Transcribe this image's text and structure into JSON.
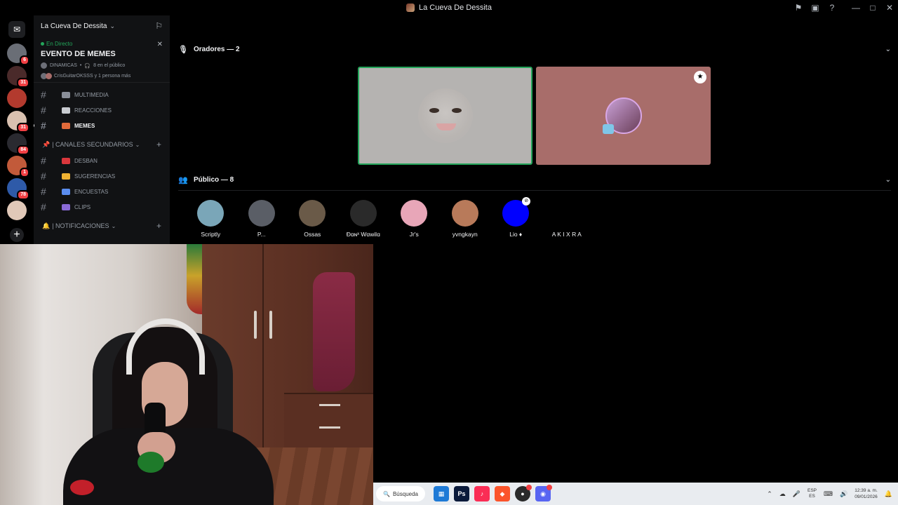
{
  "window": {
    "title": "La Cueva De Dessita",
    "controls": [
      "inbox-icon",
      "help-icon",
      "minimize-icon",
      "maximize-icon",
      "close-icon"
    ]
  },
  "servers": [
    {
      "badge": "6",
      "color": "#6a6e76"
    },
    {
      "badge": "31",
      "color": "#4a2a2a"
    },
    {
      "badge": "",
      "color": "#b33a2e"
    },
    {
      "badge": "31",
      "color": "#d9c1b0"
    },
    {
      "badge": "84",
      "color": "#2a2a30"
    },
    {
      "badge": "1",
      "color": "#c25a3a"
    },
    {
      "badge": "78",
      "color": "#2e5aa8"
    },
    {
      "badge": "",
      "color": "#e0c8b8"
    }
  ],
  "server": {
    "name": "La Cueva De Dessita",
    "live_label": "En Directo",
    "event_title": "EVENTO DE MEMES",
    "event_channel": "DINAMICAS",
    "audience_summary": "8 en el público",
    "attendees_text": "CrisGuitarOKSSS y 1 persona más",
    "channels_top": [
      {
        "name": "MULTIMEDIA",
        "emoji_color": "#8a8f99"
      },
      {
        "name": "REACCIONES",
        "emoji_color": "#c9ccd1"
      },
      {
        "name": "MEMES",
        "emoji_color": "#e06a3a",
        "active": true
      }
    ],
    "category_secondary": "| CANALES SECUNDARIOS",
    "channels_secondary": [
      {
        "name": "DESBAN",
        "emoji_color": "#da373c"
      },
      {
        "name": "SUGERENCIAS",
        "emoji_color": "#f0b232"
      },
      {
        "name": "ENCUESTAS",
        "emoji_color": "#5b8def"
      },
      {
        "name": "CLIPS",
        "emoji_color": "#8a6ad6"
      }
    ],
    "category_notifications": "| NOTIFICACIONES"
  },
  "stage": {
    "speakers_label": "Oradores — 2",
    "audience_label": "Público — 8",
    "audience": [
      {
        "name": "Scriptly",
        "color": "#7aa6b8"
      },
      {
        "name": "P...",
        "color": "#5a5e66"
      },
      {
        "name": "Ossas",
        "color": "#6a5a48"
      },
      {
        "name": "Đɑɴˣ Wɑwilɑ",
        "color": "#2a2a2a"
      },
      {
        "name": "Jr's",
        "color": "#e8a6b8"
      },
      {
        "name": "yvngkayn",
        "color": "#b87a5a"
      },
      {
        "name": "Lio ♦",
        "color": "#0000ff"
      },
      {
        "name": "A K I X R A",
        "color": "#000000"
      }
    ]
  },
  "taskbar": {
    "search_label": "Búsqueda",
    "language_top": "ESP",
    "language_bottom": "ES",
    "time": "12:39 a. m.",
    "date": "09/01/2026"
  }
}
